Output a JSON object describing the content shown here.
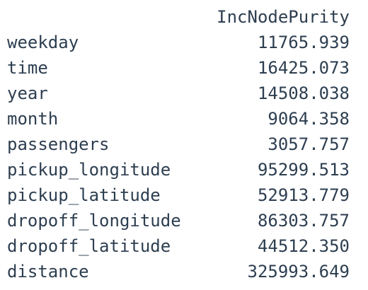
{
  "table": {
    "column_header": "IncNodePurity",
    "rows": [
      {
        "label": "weekday",
        "value": "11765.939"
      },
      {
        "label": "time",
        "value": "16425.073"
      },
      {
        "label": "year",
        "value": "14508.038"
      },
      {
        "label": "month",
        "value": "9064.358"
      },
      {
        "label": "passengers",
        "value": "3057.757"
      },
      {
        "label": "pickup_longitude",
        "value": "95299.513"
      },
      {
        "label": "pickup_latitude",
        "value": "52913.779"
      },
      {
        "label": "dropoff_longitude",
        "value": "86303.757"
      },
      {
        "label": "dropoff_latitude",
        "value": "44512.350"
      },
      {
        "label": "distance",
        "value": "325993.649"
      }
    ]
  },
  "colors": {
    "text": "#2d3e50",
    "background": "#ffffff"
  }
}
